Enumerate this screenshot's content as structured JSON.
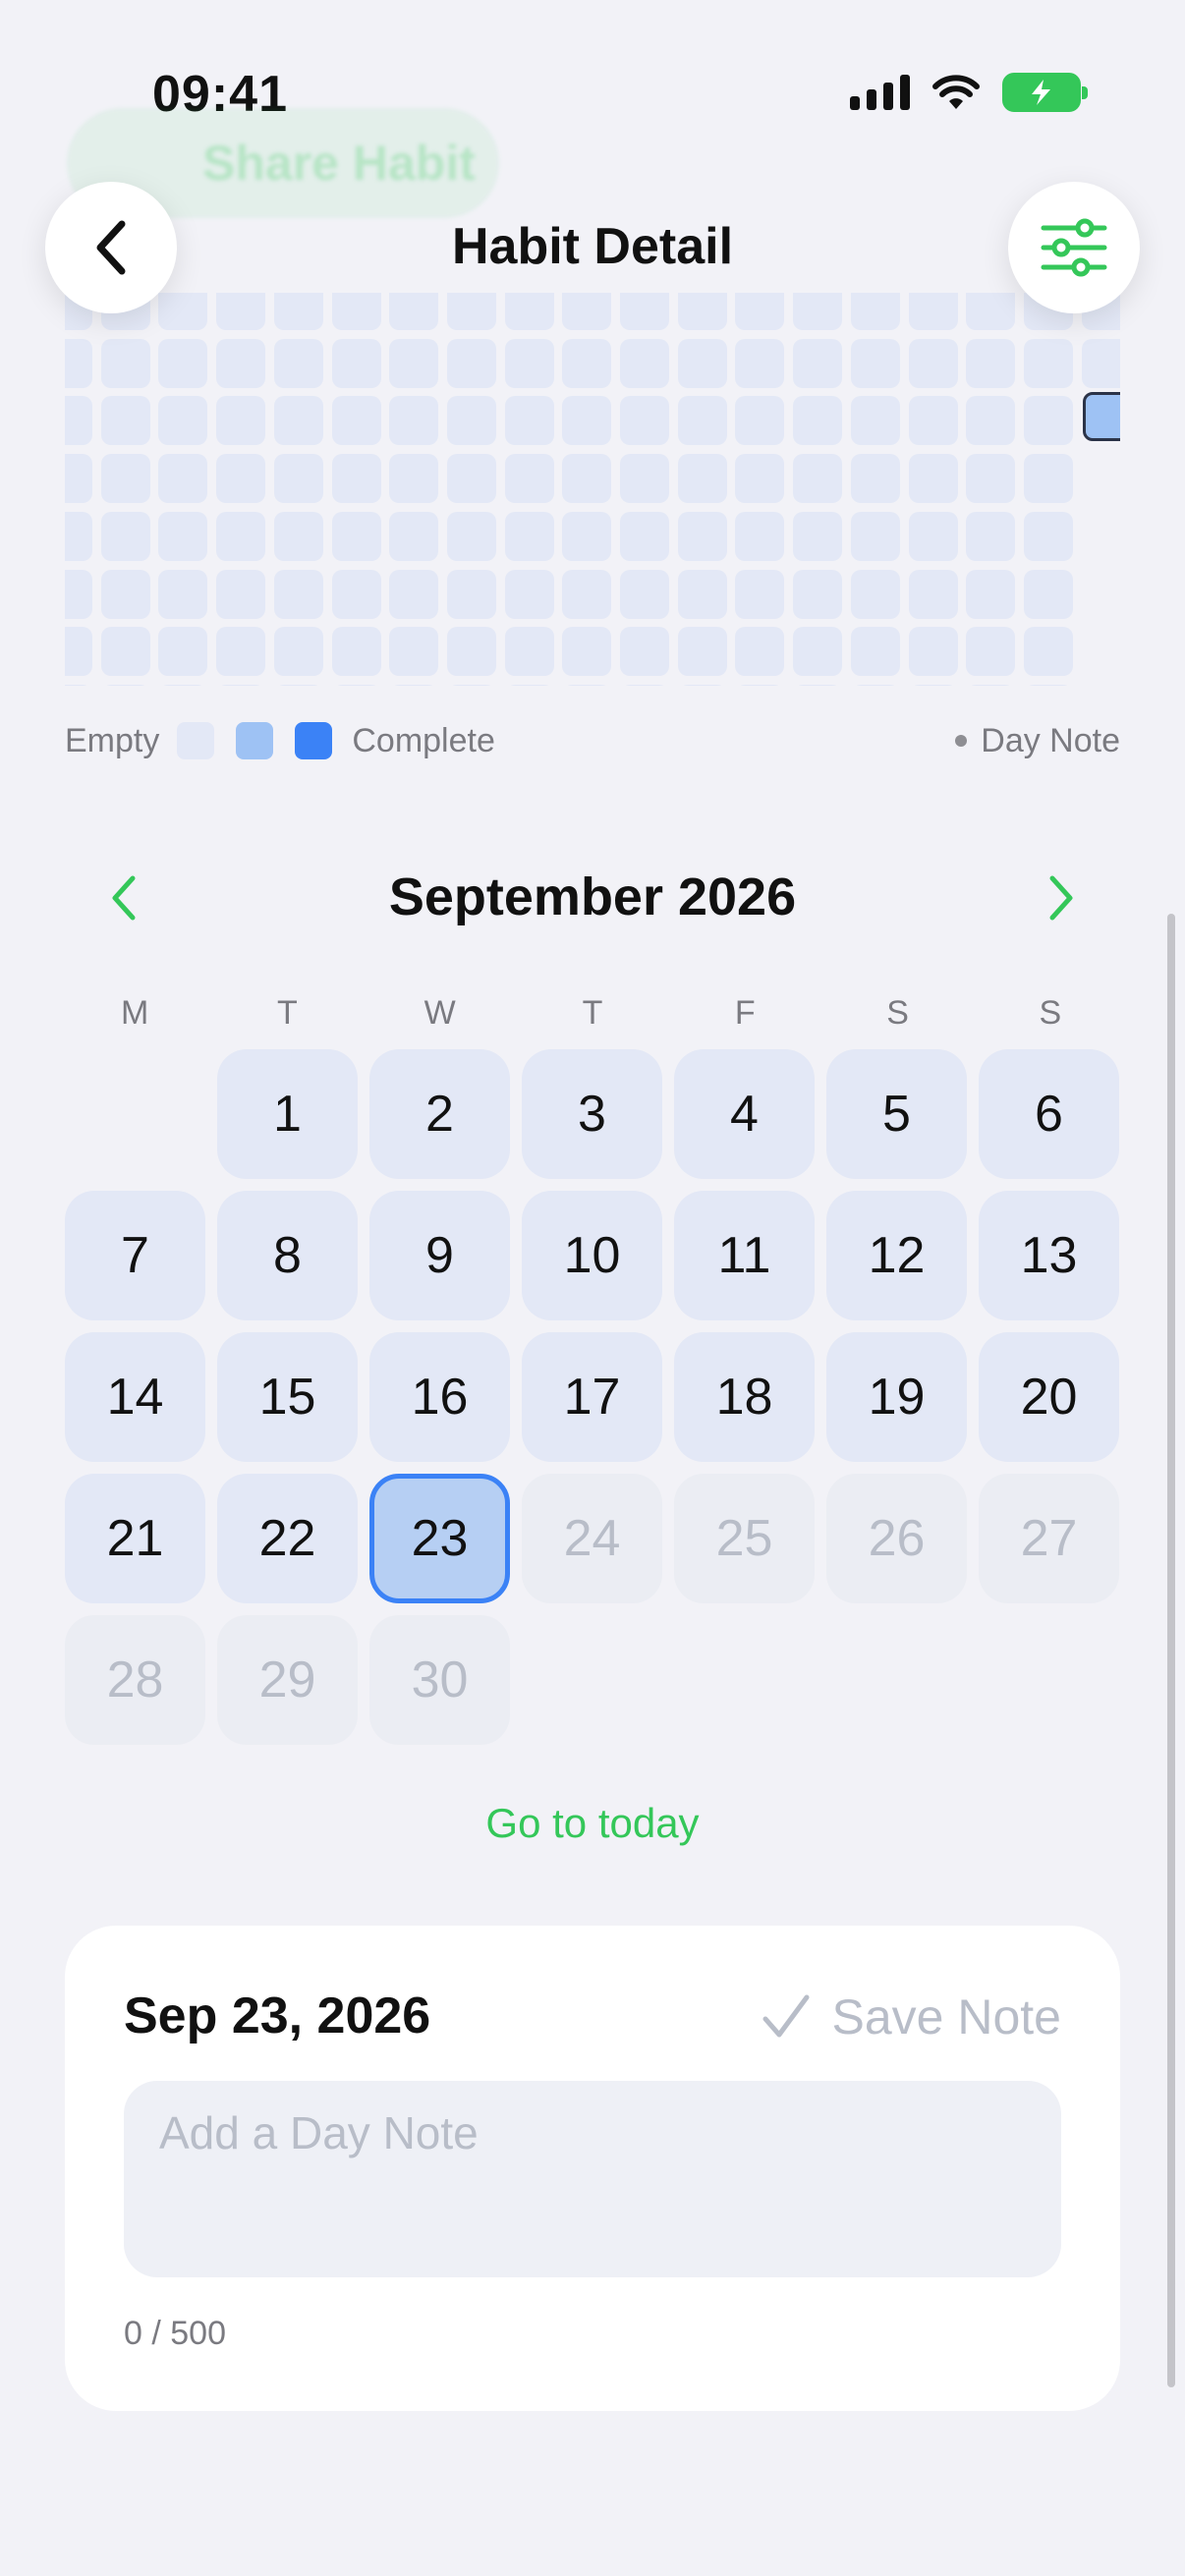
{
  "status_bar": {
    "time": "09:41"
  },
  "ghost_header": {
    "label": "Share Habit"
  },
  "nav": {
    "title": "Habit Detail",
    "back_icon": "chevron-left-icon",
    "filter_icon": "sliders-icon"
  },
  "legend": {
    "empty_label": "Empty",
    "complete_label": "Complete",
    "day_note_label": "Day Note"
  },
  "colors": {
    "accent": "#34c759",
    "empty": "#e3e8f6",
    "mid": "#9ec2f4",
    "complete": "#3b82f6"
  },
  "calendar": {
    "month_title": "September 2026",
    "weekdays": [
      "M",
      "T",
      "W",
      "T",
      "F",
      "S",
      "S"
    ],
    "leading_blanks": 1,
    "days": [
      "1",
      "2",
      "3",
      "4",
      "5",
      "6",
      "7",
      "8",
      "9",
      "10",
      "11",
      "12",
      "13",
      "14",
      "15",
      "16",
      "17",
      "18",
      "19",
      "20",
      "21",
      "22",
      "23",
      "24",
      "25",
      "26",
      "27",
      "28",
      "29",
      "30"
    ],
    "selected_day": "23",
    "last_enabled_day": 23,
    "go_today": "Go to today"
  },
  "day_note": {
    "date": "Sep 23, 2026",
    "save_label": "Save Note",
    "placeholder": "Add a Day Note",
    "value": "",
    "char_count": "0 / 500"
  }
}
